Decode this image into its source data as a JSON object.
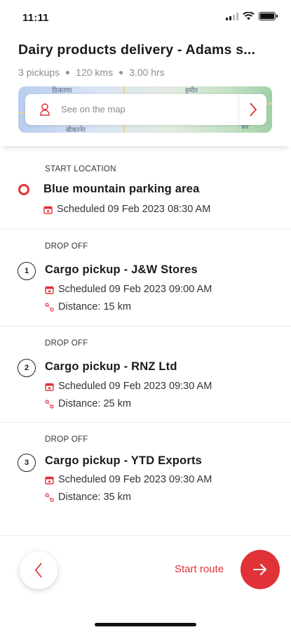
{
  "status_bar": {
    "time": "11:11"
  },
  "header": {
    "title": "Dairy products delivery - Adams s...",
    "meta": [
      "3 pickups",
      "120 kms",
      "3.00 hrs"
    ],
    "map": {
      "search_label": "See on the map",
      "labels": [
        "ठिकाणा",
        "हमीर",
        "बीकानेर",
        "सर"
      ]
    }
  },
  "stops": [
    {
      "type": "START LOCATION",
      "name": "Blue mountain parking area",
      "scheduled": "Scheduled 09 Feb 2023 08:30 AM"
    },
    {
      "type": "DROP OFF",
      "number": "1",
      "name": "Cargo pickup - J&W Stores",
      "scheduled": "Scheduled 09 Feb 2023 09:00 AM",
      "distance": "Distance: 15 km"
    },
    {
      "type": "DROP OFF",
      "number": "2",
      "name": "Cargo pickup - RNZ Ltd",
      "scheduled": "Scheduled 09 Feb 2023 09:30 AM",
      "distance": "Distance: 25 km"
    },
    {
      "type": "DROP OFF",
      "number": "3",
      "name": "Cargo pickup - YTD Exports",
      "scheduled": "Scheduled 09 Feb 2023 09:30 AM",
      "distance": "Distance: 35 km"
    }
  ],
  "footer": {
    "start_label": "Start route"
  },
  "colors": {
    "accent": "#e03237",
    "muted": "#8e8e8e"
  }
}
